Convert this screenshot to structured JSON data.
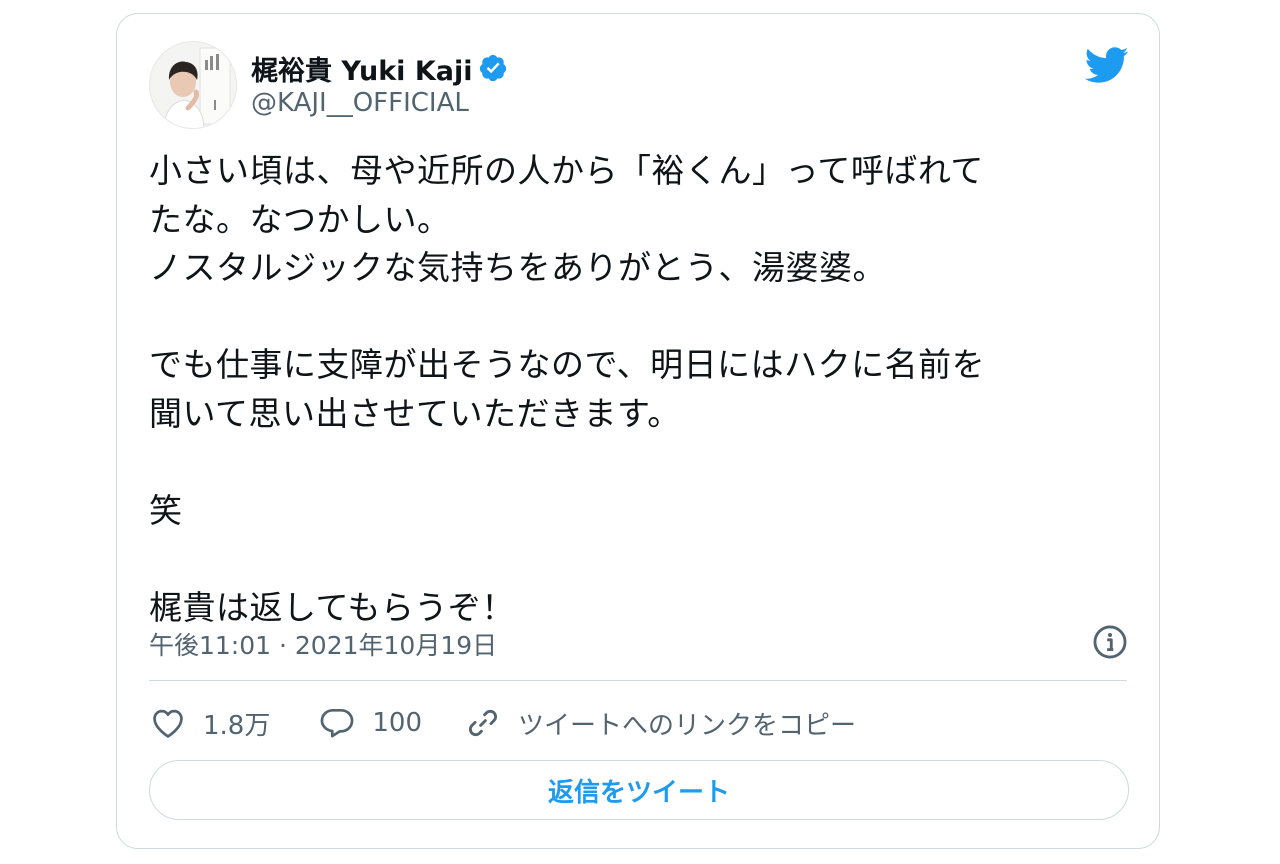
{
  "user": {
    "display_name": "梶裕貴 Yuki Kaji",
    "handle": "@KAJI__OFFICIAL",
    "verified": true
  },
  "tweet": {
    "text": "小さい頃は、母や近所の人から「裕くん」って呼ばれて\nたな。なつかしい。\nノスタルジックな気持ちをありがとう、湯婆婆。\n\nでも仕事に支障が出そうなので、明日にはハクに名前を\n聞いて思い出させていただきます。\n\n笑\n\n梶貴は返してもらうぞ！",
    "timestamp": "午後11:01 · 2021年10月19日"
  },
  "actions": {
    "like_count": "1.8万",
    "reply_count": "100",
    "copy_link_label": "ツイートへのリンクをコピー",
    "reply_button_label": "返信をツイート"
  },
  "colors": {
    "accent": "#1d9bf0",
    "text": "#0f1419",
    "secondary_text": "#536471",
    "border": "#cfd9de"
  },
  "icons": [
    "avatar",
    "verified-badge-icon",
    "twitter-bird-icon",
    "info-icon",
    "heart-icon",
    "reply-bubble-icon",
    "link-icon"
  ]
}
